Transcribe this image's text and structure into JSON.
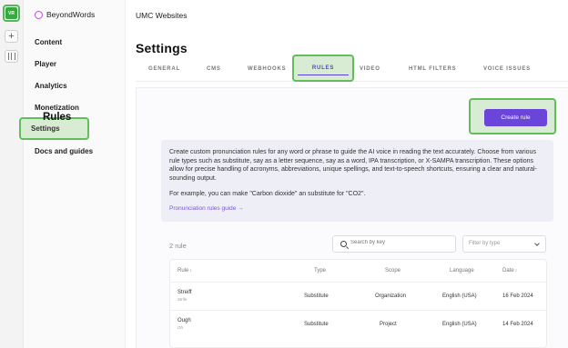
{
  "workspace": {
    "badge": "VR"
  },
  "brand": {
    "name": "BeyondWords"
  },
  "sidebar": {
    "items": [
      {
        "label": "Content"
      },
      {
        "label": "Player"
      },
      {
        "label": "Analytics"
      },
      {
        "label": "Monetization"
      },
      {
        "label": "Settings",
        "active": true
      },
      {
        "label": "Docs and guides"
      }
    ]
  },
  "header": {
    "breadcrumb": "UMC Websites",
    "title": "Settings"
  },
  "tabs": [
    {
      "label": "GENERAL"
    },
    {
      "label": "CMS"
    },
    {
      "label": "WEBHOOKS"
    },
    {
      "label": "RULES",
      "active": true
    },
    {
      "label": "VIDEO"
    },
    {
      "label": "HTML FILTERS"
    },
    {
      "label": "VOICE ISSUES"
    }
  ],
  "rules": {
    "title": "Rules",
    "create_button": "Create rule",
    "description": "Create custom pronunciation rules for any word or phrase to guide the AI voice in reading the text accurately. Choose from various rule types such as substitute, say as a letter sequence, say as a word, IPA transcription, or X-SAMPA transcription. These options allow for precise handling of acronyms, abbreviations, unique spellings, and text-to-speech shortcuts, ensuring a clear and natural-sounding output.",
    "example": "For example, you can make \"Carbon dioxide\" an substitute for \"CO2\".",
    "guide_link": "Pronunciation rules guide →",
    "count": "2 rule",
    "search_placeholder": "Search by key",
    "filter_placeholder": "Filter by type"
  },
  "table": {
    "columns": [
      {
        "label": "Rule",
        "sort": "↕"
      },
      {
        "label": "Type"
      },
      {
        "label": "Scope"
      },
      {
        "label": "Language"
      },
      {
        "label": "Date",
        "sort": "↕"
      }
    ],
    "rows": [
      {
        "rule": "Streiff",
        "sub": "Strife",
        "type": "Substitute",
        "scope": "Organization",
        "language": "English (USA)",
        "date": "16 Feb 2024"
      },
      {
        "rule": "Ough",
        "sub": "Oh",
        "type": "Substitute",
        "scope": "Project",
        "language": "English (USA)",
        "date": "14 Feb 2024"
      }
    ]
  },
  "colors": {
    "accent": "#6b45d9",
    "highlight": "#63bd5d",
    "workspace": "#39a843",
    "brand": "#c14bd8"
  }
}
